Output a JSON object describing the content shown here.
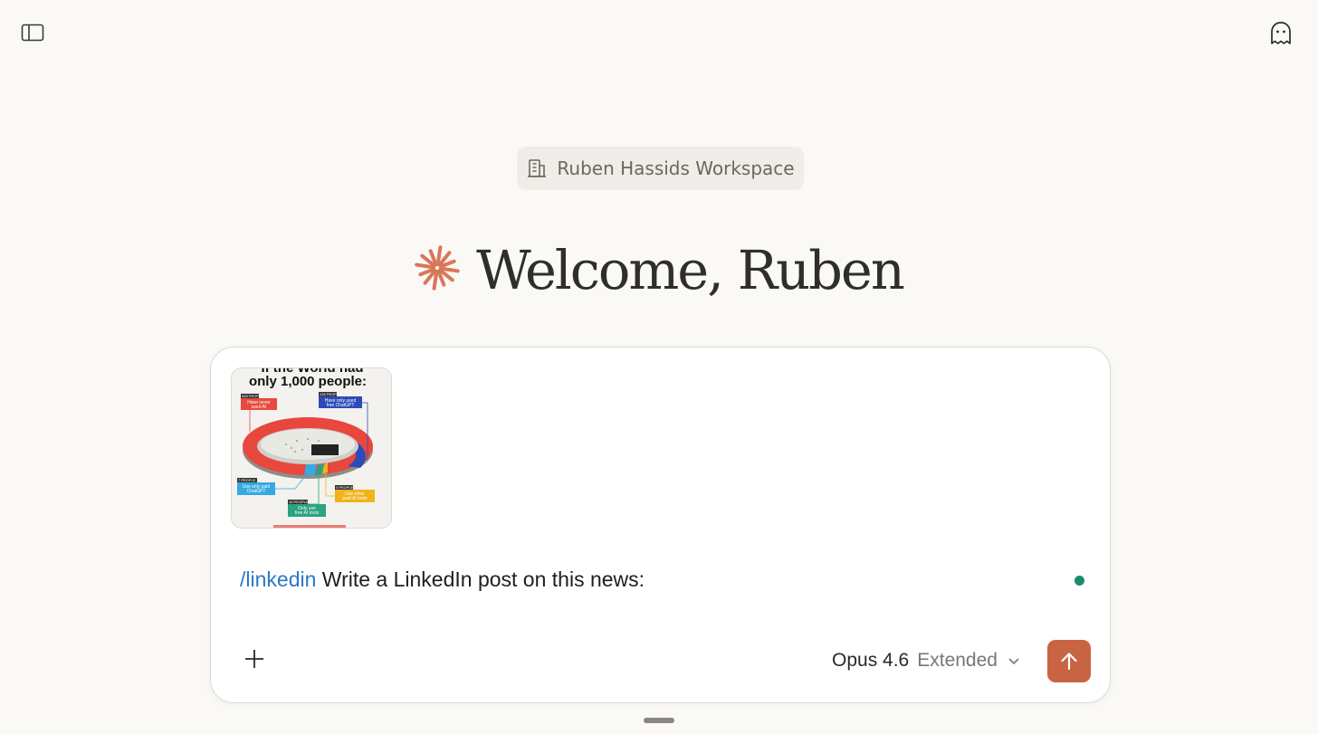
{
  "header": {
    "sidebar_toggle_icon": "sidebar-toggle-icon",
    "incognito_icon": "ghost-icon"
  },
  "workspace": {
    "icon": "building-icon",
    "label": "Ruben Hassids Workspace"
  },
  "welcome": {
    "logo_icon": "claude-spark-logo",
    "logo_color": "#d9775a",
    "title": "Welcome, Ruben"
  },
  "composer": {
    "attachment": {
      "title_line1": "If the World had",
      "title_line2": "only 1,000 people:",
      "callouts": [
        {
          "count": "848 PEOPLE",
          "text1": "Have never",
          "text2": "used AI",
          "color": "#e84a3f"
        },
        {
          "count": "126 PEOPLE",
          "text1": "Have only used",
          "text2": "free ChatGPT",
          "color": "#2c4bb8"
        },
        {
          "count": "7 PEOPLE",
          "text1": "Use only paid",
          "text2": "ChatGPT",
          "color": "#36a9e0"
        },
        {
          "count": "16 PEOPLE",
          "text1": "Only use",
          "text2": "free AI tools",
          "color": "#2aa37f"
        },
        {
          "count": "4 PEOPLE",
          "text1": "Use other",
          "text2": "paid AI tools",
          "color": "#f0b31c"
        }
      ]
    },
    "command": "/linkedin",
    "prompt_text": " Write a LinkedIn post on this news:",
    "status_color": "#1c8a6c",
    "add_icon": "plus-icon",
    "model_name": "Opus 4.6",
    "model_mode": "Extended",
    "model_chevron_icon": "chevron-down-icon",
    "send_icon": "arrow-up-icon",
    "send_color": "#c96442"
  }
}
